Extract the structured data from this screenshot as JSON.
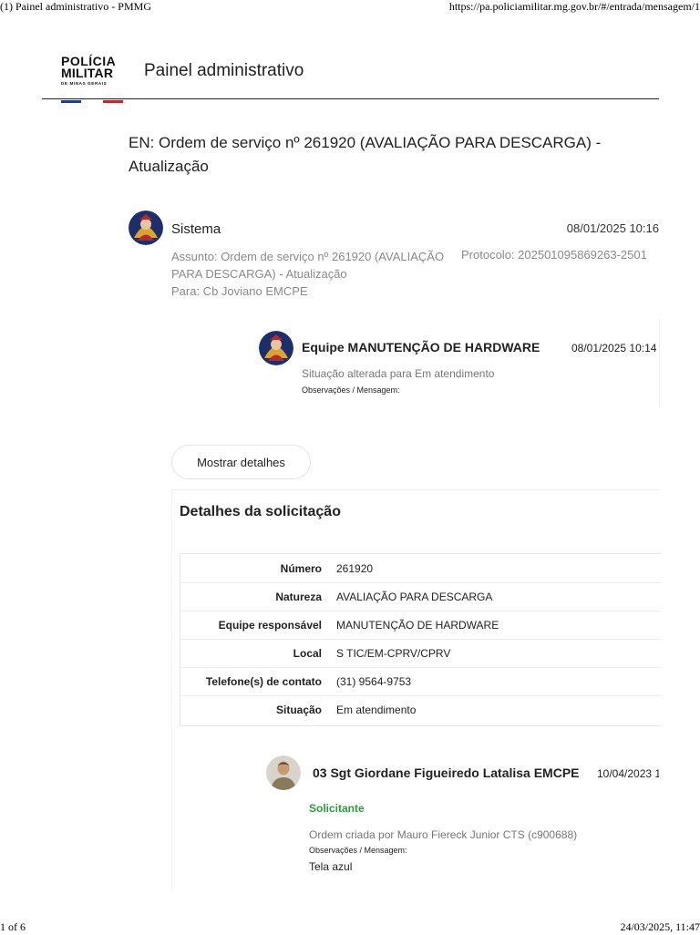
{
  "print_header": {
    "left": "(1) Painel administrativo - PMMG",
    "right": "https://pa.policiamilitar.mg.gov.br/#/entrada/mensagem/1"
  },
  "brand": {
    "logo_line1": "POLÍCIA",
    "logo_line2": "MILITAR",
    "logo_line3": "DE MINAS GERAIS",
    "title": "Painel administrativo"
  },
  "page_title": "EN: Ordem de serviço nº 261920 (AVALIAÇÃO PARA DESCARGA) - Atualização",
  "system_message": {
    "sender": "Sistema",
    "date": "08/01/2025 10:16",
    "subject": "Assunto: Ordem de serviço nº 261920 (AVALIAÇÃO PARA DESCARGA) - Atualização",
    "protocol": "Protocolo: 202501095869263-2501",
    "to": "Para: Cb Joviano EMCPE"
  },
  "reply": {
    "sender": "Equipe MANUTENÇÃO DE HARDWARE",
    "date": "08/01/2025 10:14",
    "status_text": "Situação alterada para Em atendimento",
    "obs_label": "Observações / Mensagem:"
  },
  "show_details_label": "Mostrar detalhes",
  "details": {
    "title": "Detalhes da solicitação",
    "rows": [
      {
        "label": "Número",
        "value": "261920"
      },
      {
        "label": "Natureza",
        "value": "AVALIAÇÃO PARA DESCARGA"
      },
      {
        "label": "Equipe responsável",
        "value": "MANUTENÇÃO DE HARDWARE"
      },
      {
        "label": "Local",
        "value": "S TIC/EM-CPRV/CPRV"
      },
      {
        "label": "Telefone(s) de contato",
        "value": "(31) 9564-9753"
      },
      {
        "label": "Situação",
        "value": "Em atendimento"
      }
    ]
  },
  "first_message": {
    "sender": "03 Sgt Giordane Figueiredo Latalisa EMCPE",
    "date": "10/04/2023 1",
    "role": "Solicitante",
    "created_by": "Ordem criada por  Mauro Fiereck Junior CTS (c900688)",
    "obs_label": "Observações / Mensagem:",
    "message": "Tela azul"
  },
  "print_footer": {
    "left": "1 of 6",
    "right": "24/03/2025, 11:47"
  }
}
